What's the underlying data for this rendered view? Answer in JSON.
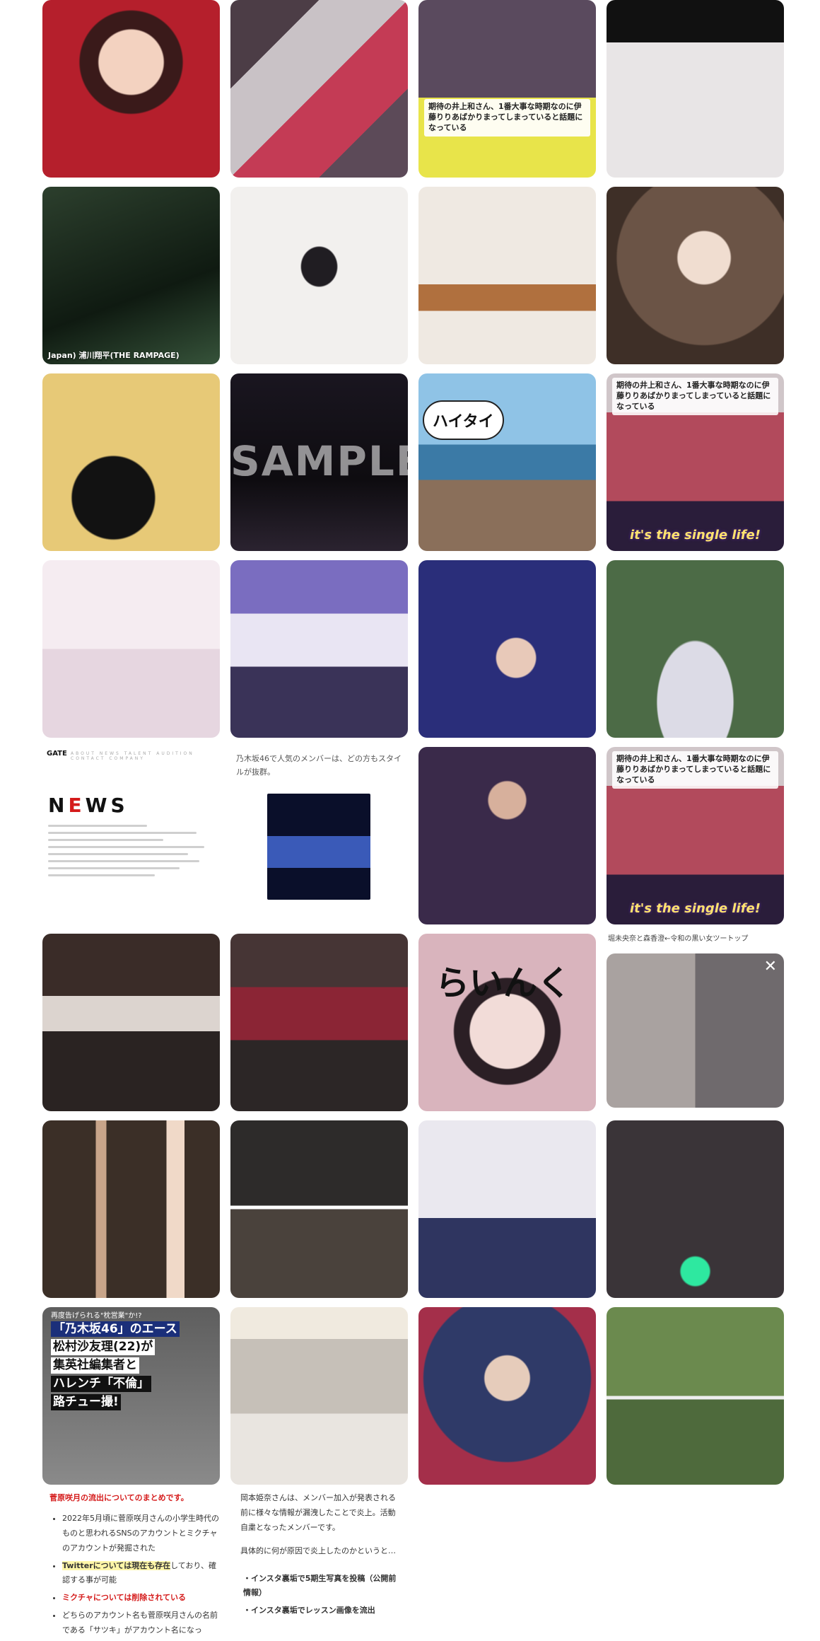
{
  "tiles": [
    {
      "id": "r1c1",
      "bg": "#b51f2c",
      "cap": ""
    },
    {
      "id": "r1c2",
      "bg": "#6b5a68",
      "cap": ""
    },
    {
      "id": "r1c3",
      "bg": "#3b3550",
      "cap": "期待の井上和さん、1番大事な時期なのに伊藤りりあばかりまってしまっていると話題になっている"
    },
    {
      "id": "r1c4",
      "bg": "#d9d6d8",
      "cap": ""
    },
    {
      "id": "r2c1",
      "bg": "#1e2b1f",
      "cap": "Japan) 浦川翔平(THE RAMPAGE)"
    },
    {
      "id": "r2c2",
      "bg": "#f2f0ee",
      "cap": ""
    },
    {
      "id": "r2c3",
      "bg": "#e9e3dc",
      "cap": ""
    },
    {
      "id": "r2c4",
      "bg": "#5a4a40",
      "cap": ""
    },
    {
      "id": "r3c1",
      "bg": "#e7c977",
      "cap": ""
    },
    {
      "id": "r3c2",
      "bg": "#161318",
      "cap": "SAMPLE"
    },
    {
      "id": "r3c3",
      "bg": "#5d9ac1",
      "cap": "ハイタイ"
    },
    {
      "id": "r3c4",
      "bg": "#b24a5c",
      "cap": "期待の井上和さん、1番大事な時期なのに伊藤りりあばかりまってしまっていると話題になっている"
    },
    {
      "id": "r4c1",
      "bg": "#f0e5ee",
      "cap": ""
    },
    {
      "id": "r4c2",
      "bg": "#6d62a8",
      "cap": ""
    },
    {
      "id": "r4c3",
      "bg": "#2a2e7a",
      "cap": ""
    },
    {
      "id": "r4c4",
      "bg": "#4c6b46",
      "cap": ""
    },
    {
      "id": "r5c3",
      "bg": "#3a2a4a",
      "cap": ""
    },
    {
      "id": "r5c4",
      "bg": "#b24a5c",
      "cap": "期待の井上和さん、1番大事な時期なのに伊藤りりあばかりまってしまっていると話題になっている"
    },
    {
      "id": "r6c1",
      "bg": "#2a2322",
      "cap": ""
    },
    {
      "id": "r6c2",
      "bg": "#2c2626",
      "cap": ""
    },
    {
      "id": "r6c3",
      "bg": "#d9b4bd",
      "cap": "らいんく"
    },
    {
      "id": "r6c4",
      "bg": "#8a8a8f",
      "cap": ""
    },
    {
      "id": "r7c1",
      "bg": "#3b2f27",
      "cap": ""
    },
    {
      "id": "r7c2",
      "bg": "#2d2b2a",
      "cap": ""
    },
    {
      "id": "r7c3",
      "bg": "#eae8ef",
      "cap": ""
    },
    {
      "id": "r7c4",
      "bg": "#3a3438",
      "cap": ""
    },
    {
      "id": "r8c1",
      "bg": "#6a6a6a",
      "cap": ""
    },
    {
      "id": "r8c2",
      "bg": "#e9e5e0",
      "cap": ""
    },
    {
      "id": "r8c3",
      "bg": "#2f3a68",
      "cap": ""
    },
    {
      "id": "r8c4",
      "bg": "#4e6a3c",
      "cap": ""
    }
  ],
  "news_tile": {
    "logo": "GATE",
    "nav": "ABOUT  NEWS  TALENT  AUDITION  CONTACT  COMPANY",
    "big_pre": "N",
    "big_mid": "E",
    "big_post": "WS"
  },
  "article_tile": {
    "text": "乃木坂46で人気のメンバーは、どの方もスタイルが抜群。"
  },
  "caption_r5c4": "堀未央奈と森香澄←令和の黒い女ツートップ",
  "sample_text": "SAMPLE",
  "bubble_text": "ハイタイ",
  "single_life": "it's the single life!",
  "scribble_text": "らいんく",
  "magazine": {
    "lines": [
      "再度告げられる\"枕営業\"か!?",
      "「乃木坂46」のエース",
      "松村沙友理(22)が",
      "集英社編集者と",
      "ハレンチ「不倫」",
      "路チュー撮!"
    ]
  },
  "left_block": {
    "heading": "菅原咲月の流出についてのまとめです。",
    "items": [
      {
        "pre": "2022年5月頃に菅原咲月さんの小学生時代のものと思われるSNSのアカウントとミクチャのアカウントが発掘された",
        "em": "",
        "post": ""
      },
      {
        "pre": "",
        "em": "Twitterについては現在も存在",
        "post": "しており、確認する事が可能"
      },
      {
        "pre": "",
        "em": "ミクチャについては削除されている",
        "post": ""
      },
      {
        "pre": "どちらのアカウント名も菅原咲月さんの名前である「サツキ」がアカウント名になっ",
        "em": "",
        "post": ""
      }
    ]
  },
  "right_block": {
    "p1": "岡本姫奈さんは、メンバー加入が発表される前に様々な情報が漏洩したことで炎上。活動自粛となったメンバーです。",
    "p2": "具体的に何が原因で炎上したのかというと…",
    "items": [
      "インスタ裏垢で5期生写真を投稿（公開前情報）",
      "インスタ裏垢でレッスン画像を流出"
    ]
  }
}
